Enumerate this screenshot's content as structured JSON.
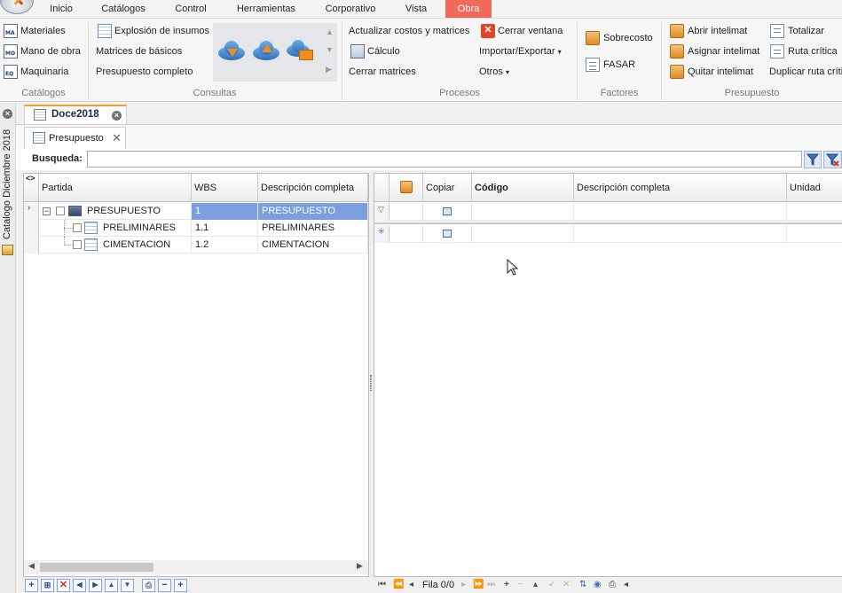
{
  "menu": {
    "tabs": [
      "Inicio",
      "Catálogos",
      "Control",
      "Herramientas",
      "Corporativo",
      "Vista",
      "Obra"
    ],
    "active_tab": "Obra"
  },
  "ribbon": {
    "catalogos": {
      "title": "Catálogos",
      "items": [
        {
          "label": "Materiales",
          "icon": "ma-doc-icon",
          "tag": "MA"
        },
        {
          "label": "Mano de obra",
          "icon": "mo-doc-icon",
          "tag": "MO"
        },
        {
          "label": "Maquinaria",
          "icon": "eq-doc-icon",
          "tag": "EQ"
        }
      ]
    },
    "consultas": {
      "title": "Consultas",
      "items": [
        "Explosión de insumos",
        "Matrices de básicos",
        "Presupuesto completo"
      ]
    },
    "procesos": {
      "title": "Procesos",
      "items": [
        "Actualizar costos y matrices",
        "Cálculo",
        "Cerrar matrices",
        "Cerrar ventana",
        "Importar/Exportar",
        "Otros"
      ]
    },
    "factores": {
      "title": "Factores",
      "items": [
        "Sobrecosto",
        "FASAR"
      ]
    },
    "presupuesto": {
      "title": "Presupuesto",
      "items": [
        "Abrir intelimat",
        "Asignar intelimat",
        "Quitar intelimat",
        "Totalizar",
        "Ruta crítica",
        "Duplicar ruta crítica"
      ]
    }
  },
  "side_panel": {
    "label": "Catalogo Diciembre 2018"
  },
  "document": {
    "tab_title": "Doce2018",
    "subtab_title": "Presupuesto"
  },
  "search": {
    "label": "Busqueda:",
    "value": ""
  },
  "left_grid": {
    "toggle": "<>",
    "columns": [
      "Partida",
      "WBS",
      "Descripción completa"
    ],
    "rows": [
      {
        "partida": "PRESUPUESTO",
        "wbs": "1",
        "descripcion": "PRESUPUESTO",
        "selected": true
      },
      {
        "partida": "PRELIMINARES",
        "wbs": "1.1",
        "descripcion": "PRELIMINARES",
        "selected": false
      },
      {
        "partida": "CIMENTACION",
        "wbs": "1.2",
        "descripcion": "CIMENTACION",
        "selected": false
      }
    ]
  },
  "right_grid": {
    "columns": [
      "",
      "Copiar",
      "Código",
      "Descripción completa",
      "Unidad"
    ]
  },
  "right_nav": {
    "record_text": "Fila 0/0"
  },
  "colors": {
    "active_tab": "#ef6a5a",
    "selection": "#7b9fde",
    "accent_orange": "#f0a030"
  }
}
